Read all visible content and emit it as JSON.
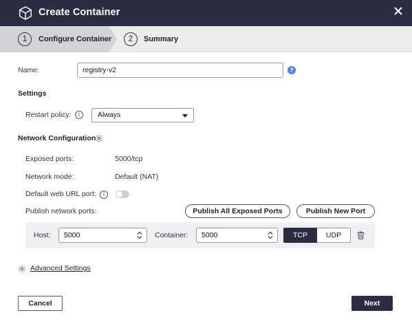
{
  "header": {
    "title": "Create Container",
    "icon": "cube-icon",
    "close_icon": "close-icon"
  },
  "steps": [
    {
      "number": "1",
      "label": "Configure Container",
      "active": true
    },
    {
      "number": "2",
      "label": "Summary",
      "active": false
    }
  ],
  "name": {
    "label": "Name:",
    "value": "registry-v2",
    "help_icon": "question-icon"
  },
  "settings": {
    "heading": "Settings",
    "restart_policy_label": "Restart policy:",
    "restart_policy_value": "Always"
  },
  "network": {
    "heading": "Network Configuration",
    "exposed_ports_label": "Exposed ports:",
    "exposed_ports_value": "5000/tcp",
    "network_mode_label": "Network mode:",
    "network_mode_value": "Default (NAT)",
    "default_web_url_label": "Default web URL port:",
    "default_web_url_enabled": false,
    "publish_label": "Publish network ports:",
    "publish_all_button": "Publish All Exposed Ports",
    "publish_new_button": "Publish New Port",
    "port_row": {
      "host_label": "Host:",
      "host_value": "5000",
      "container_label": "Container:",
      "container_value": "5000",
      "protocols": [
        "TCP",
        "UDP"
      ],
      "selected_protocol": "TCP",
      "delete_icon": "trash-icon"
    }
  },
  "advanced": {
    "label": "Advanced Settings",
    "icon": "gear-icon"
  },
  "footer": {
    "cancel_label": "Cancel",
    "next_label": "Next"
  },
  "colors": {
    "header_bg": "#2b2d42",
    "primary": "#2b2d42",
    "help_blue": "#4a84e0",
    "row_bg": "#f0f0f4"
  }
}
